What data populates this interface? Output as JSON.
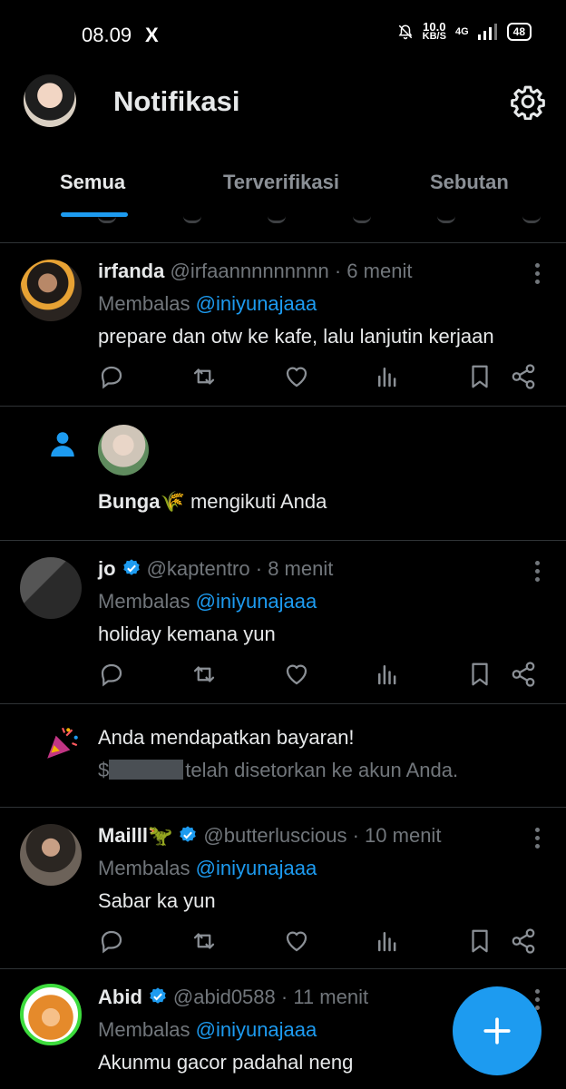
{
  "status_bar": {
    "time": "08.09",
    "x_logo": "X",
    "net_speed_value": "10.0",
    "net_speed_unit": "KB/S",
    "net_type": "4G",
    "battery": "48"
  },
  "header": {
    "title": "Notifikasi",
    "settings_icon": "gear-icon"
  },
  "tabs": [
    {
      "label": "Semua",
      "active": true
    },
    {
      "label": "Terverifikasi",
      "active": false
    },
    {
      "label": "Sebutan",
      "active": false
    }
  ],
  "notifications": {
    "irfanda": {
      "name": "irfanda",
      "handle": "@irfaannnnnnnnn",
      "time": "· 6 menit",
      "reply_prefix": "Membalas",
      "reply_mention": "@iniyunajaaa",
      "text": "prepare dan otw ke kafe, lalu lanjutin kerjaan"
    },
    "follow": {
      "name": "Bunga🌾",
      "text": " mengikuti Anda"
    },
    "jo": {
      "name": "jo",
      "handle": "@kaptentro",
      "time": "· 8 menit",
      "reply_prefix": "Membalas",
      "reply_mention": "@iniyunajaaa",
      "text": "holiday kemana yun"
    },
    "payment": {
      "title": "Anda mendapatkan bayaran!",
      "currency": "$",
      "suffix": "telah disetorkan ke akun Anda."
    },
    "maill": {
      "name": "Mailll🦖",
      "handle": "@butterluscious",
      "time": "· 10 menit",
      "reply_prefix": "Membalas",
      "reply_mention": "@iniyunajaaa",
      "text": "Sabar ka yun"
    },
    "abid": {
      "name": "Abid",
      "handle": "@abid0588",
      "time": "· 11 menit",
      "reply_prefix": "Membalas",
      "reply_mention": "@iniyunajaaa",
      "text": "Akunmu gacor padahal neng"
    }
  },
  "colors": {
    "accent": "#1d9bf0",
    "background": "#000000",
    "muted": "#71767b",
    "divider": "#2f3336"
  },
  "fab_icon": "plus-icon"
}
